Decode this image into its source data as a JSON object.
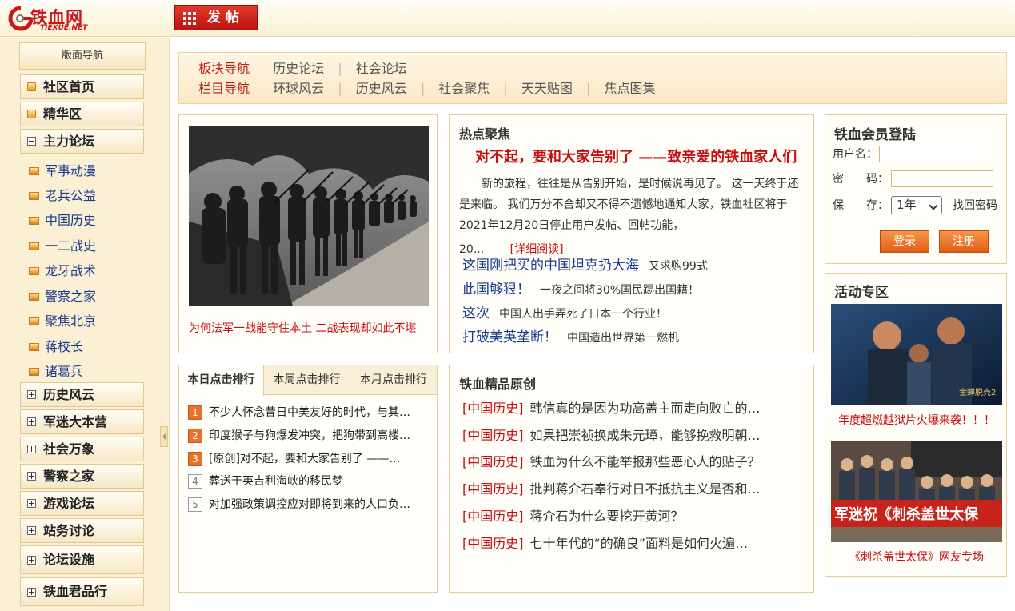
{
  "logo": {
    "name": "铁血网",
    "sub": "TIEXUE.NET"
  },
  "toolbar": {
    "post_label": "发帖"
  },
  "sidebar": {
    "title": "版面导航",
    "top_items": [
      {
        "label": "社区首页"
      },
      {
        "label": "精华区"
      }
    ],
    "main_forum": {
      "label": "主力论坛"
    },
    "sub_items": [
      {
        "label": "军事动漫"
      },
      {
        "label": "老兵公益"
      },
      {
        "label": "中国历史"
      },
      {
        "label": "一二战史"
      },
      {
        "label": "龙牙战术"
      },
      {
        "label": "警察之家"
      },
      {
        "label": "聚焦北京"
      },
      {
        "label": "蒋校长"
      },
      {
        "label": "诸葛兵"
      }
    ],
    "groups": [
      {
        "label": "历史风云"
      },
      {
        "label": "军迷大本营"
      },
      {
        "label": "社会万象"
      },
      {
        "label": "警察之家"
      },
      {
        "label": "游戏论坛"
      },
      {
        "label": "站务讨论"
      },
      {
        "label": "论坛设施"
      },
      {
        "label": "铁血君品行"
      }
    ]
  },
  "nav": {
    "board_label": "板块导航",
    "board_items": [
      "历史论坛",
      "社会论坛"
    ],
    "column_label": "栏目导航",
    "column_items": [
      "环球风云",
      "历史风云",
      "社会聚焦",
      "天天贴图",
      "焦点图集"
    ]
  },
  "photo": {
    "caption": "为何法军一战能守住本土 二战表现却如此不堪"
  },
  "hot": {
    "title": "热点聚焦",
    "headline": "对不起，要和大家告别了 ——致亲爱的铁血家人们",
    "body": "新的旅程，往往是从告别开始，是时候说再见了。 这一天终于还是来临。 我们万分不舍却又不得不遗憾地通知大家，铁血社区将于2021年12月20日停止用户发帖、回帖功能，",
    "ellipsis": "20...",
    "more": "[详细阅读]",
    "links": [
      {
        "a": "这国刚把买的中国坦克扔大海",
        "b": "又求购99式"
      },
      {
        "a": "此国够狠！",
        "b": "一夜之间将30%国民踢出国籍！"
      },
      {
        "a": "这次",
        "b": "中国人出手弄死了日本一个行业！"
      },
      {
        "a": "打破美英垄断！",
        "b": "中国造出世界第一燃机"
      }
    ]
  },
  "login": {
    "title": "铁血会员登陆",
    "username_label": "用户名：",
    "password_label": "密　　码：",
    "remember_label": "保　　存：",
    "remember_value": "1年",
    "find_password": "找回密码",
    "login_button": "登录",
    "register_button": "注册"
  },
  "rank": {
    "tabs": [
      "本日点击排行",
      "本周点击排行",
      "本月点击排行"
    ],
    "active_tab": 0,
    "items": [
      {
        "num": "1",
        "title": "不少人怀念昔日中美友好的时代，与其…"
      },
      {
        "num": "2",
        "title": "印度猴子与狗爆发冲突，把狗带到高楼…"
      },
      {
        "num": "3",
        "title": "[原创]对不起，要和大家告别了 ——…"
      },
      {
        "num": "4",
        "title": "葬送于英吉利海峡的移民梦"
      },
      {
        "num": "5",
        "title": "对加强政策调控应对即将到来的人口负…"
      }
    ]
  },
  "original": {
    "title": "铁血精品原创",
    "items": [
      {
        "cat": "[中国历史]",
        "title": "韩信真的是因为功高盖主而走向败亡的…"
      },
      {
        "cat": "[中国历史]",
        "title": "如果把崇祯换成朱元璋，能够挽救明朝…"
      },
      {
        "cat": "[中国历史]",
        "title": "铁血为什么不能举报那些恶心人的贴子？"
      },
      {
        "cat": "[中国历史]",
        "title": "批判蒋介石奉行对日不抵抗主义是否和…"
      },
      {
        "cat": "[中国历史]",
        "title": "蒋介石为什么要挖开黄河？"
      },
      {
        "cat": "[中国历史]",
        "title": "七十年代的“的确良”面料是如何火遍…"
      }
    ]
  },
  "activity": {
    "title": "活动专区",
    "items": [
      {
        "caption": "年度超燃越狱片火爆来袭！！！",
        "image_text": "金蝉脱壳2"
      },
      {
        "caption": "《刺杀盖世太保》网友专场",
        "image_text": "军迷祝《刺杀盖世太保"
      }
    ]
  },
  "colors": {
    "accent": "#c80d0d",
    "link": "#1a3a8e",
    "panel_border": "#e6cc96",
    "sidebar_bg": "#fbf0d3",
    "orange_button": "#e35e15"
  }
}
